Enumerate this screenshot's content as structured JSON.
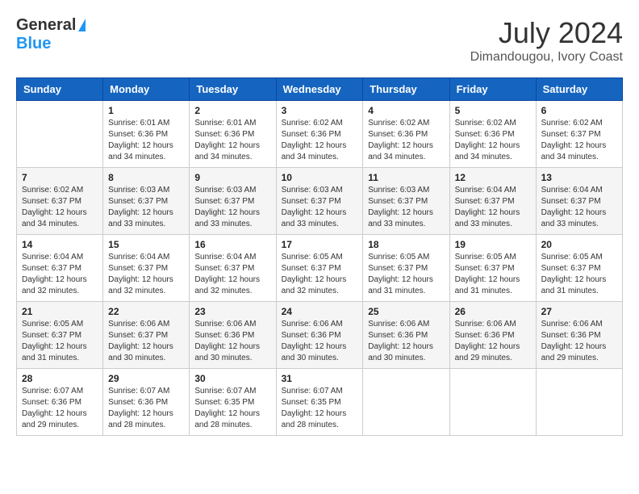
{
  "header": {
    "logo_general": "General",
    "logo_blue": "Blue",
    "month": "July 2024",
    "location": "Dimandougou, Ivory Coast"
  },
  "days_of_week": [
    "Sunday",
    "Monday",
    "Tuesday",
    "Wednesday",
    "Thursday",
    "Friday",
    "Saturday"
  ],
  "weeks": [
    [
      {
        "day": "",
        "info": ""
      },
      {
        "day": "1",
        "info": "Sunrise: 6:01 AM\nSunset: 6:36 PM\nDaylight: 12 hours\nand 34 minutes."
      },
      {
        "day": "2",
        "info": "Sunrise: 6:01 AM\nSunset: 6:36 PM\nDaylight: 12 hours\nand 34 minutes."
      },
      {
        "day": "3",
        "info": "Sunrise: 6:02 AM\nSunset: 6:36 PM\nDaylight: 12 hours\nand 34 minutes."
      },
      {
        "day": "4",
        "info": "Sunrise: 6:02 AM\nSunset: 6:36 PM\nDaylight: 12 hours\nand 34 minutes."
      },
      {
        "day": "5",
        "info": "Sunrise: 6:02 AM\nSunset: 6:36 PM\nDaylight: 12 hours\nand 34 minutes."
      },
      {
        "day": "6",
        "info": "Sunrise: 6:02 AM\nSunset: 6:37 PM\nDaylight: 12 hours\nand 34 minutes."
      }
    ],
    [
      {
        "day": "7",
        "info": "Sunrise: 6:02 AM\nSunset: 6:37 PM\nDaylight: 12 hours\nand 34 minutes."
      },
      {
        "day": "8",
        "info": "Sunrise: 6:03 AM\nSunset: 6:37 PM\nDaylight: 12 hours\nand 33 minutes."
      },
      {
        "day": "9",
        "info": "Sunrise: 6:03 AM\nSunset: 6:37 PM\nDaylight: 12 hours\nand 33 minutes."
      },
      {
        "day": "10",
        "info": "Sunrise: 6:03 AM\nSunset: 6:37 PM\nDaylight: 12 hours\nand 33 minutes."
      },
      {
        "day": "11",
        "info": "Sunrise: 6:03 AM\nSunset: 6:37 PM\nDaylight: 12 hours\nand 33 minutes."
      },
      {
        "day": "12",
        "info": "Sunrise: 6:04 AM\nSunset: 6:37 PM\nDaylight: 12 hours\nand 33 minutes."
      },
      {
        "day": "13",
        "info": "Sunrise: 6:04 AM\nSunset: 6:37 PM\nDaylight: 12 hours\nand 33 minutes."
      }
    ],
    [
      {
        "day": "14",
        "info": "Sunrise: 6:04 AM\nSunset: 6:37 PM\nDaylight: 12 hours\nand 32 minutes."
      },
      {
        "day": "15",
        "info": "Sunrise: 6:04 AM\nSunset: 6:37 PM\nDaylight: 12 hours\nand 32 minutes."
      },
      {
        "day": "16",
        "info": "Sunrise: 6:04 AM\nSunset: 6:37 PM\nDaylight: 12 hours\nand 32 minutes."
      },
      {
        "day": "17",
        "info": "Sunrise: 6:05 AM\nSunset: 6:37 PM\nDaylight: 12 hours\nand 32 minutes."
      },
      {
        "day": "18",
        "info": "Sunrise: 6:05 AM\nSunset: 6:37 PM\nDaylight: 12 hours\nand 31 minutes."
      },
      {
        "day": "19",
        "info": "Sunrise: 6:05 AM\nSunset: 6:37 PM\nDaylight: 12 hours\nand 31 minutes."
      },
      {
        "day": "20",
        "info": "Sunrise: 6:05 AM\nSunset: 6:37 PM\nDaylight: 12 hours\nand 31 minutes."
      }
    ],
    [
      {
        "day": "21",
        "info": "Sunrise: 6:05 AM\nSunset: 6:37 PM\nDaylight: 12 hours\nand 31 minutes."
      },
      {
        "day": "22",
        "info": "Sunrise: 6:06 AM\nSunset: 6:37 PM\nDaylight: 12 hours\nand 30 minutes."
      },
      {
        "day": "23",
        "info": "Sunrise: 6:06 AM\nSunset: 6:36 PM\nDaylight: 12 hours\nand 30 minutes."
      },
      {
        "day": "24",
        "info": "Sunrise: 6:06 AM\nSunset: 6:36 PM\nDaylight: 12 hours\nand 30 minutes."
      },
      {
        "day": "25",
        "info": "Sunrise: 6:06 AM\nSunset: 6:36 PM\nDaylight: 12 hours\nand 30 minutes."
      },
      {
        "day": "26",
        "info": "Sunrise: 6:06 AM\nSunset: 6:36 PM\nDaylight: 12 hours\nand 29 minutes."
      },
      {
        "day": "27",
        "info": "Sunrise: 6:06 AM\nSunset: 6:36 PM\nDaylight: 12 hours\nand 29 minutes."
      }
    ],
    [
      {
        "day": "28",
        "info": "Sunrise: 6:07 AM\nSunset: 6:36 PM\nDaylight: 12 hours\nand 29 minutes."
      },
      {
        "day": "29",
        "info": "Sunrise: 6:07 AM\nSunset: 6:36 PM\nDaylight: 12 hours\nand 28 minutes."
      },
      {
        "day": "30",
        "info": "Sunrise: 6:07 AM\nSunset: 6:35 PM\nDaylight: 12 hours\nand 28 minutes."
      },
      {
        "day": "31",
        "info": "Sunrise: 6:07 AM\nSunset: 6:35 PM\nDaylight: 12 hours\nand 28 minutes."
      },
      {
        "day": "",
        "info": ""
      },
      {
        "day": "",
        "info": ""
      },
      {
        "day": "",
        "info": ""
      }
    ]
  ]
}
